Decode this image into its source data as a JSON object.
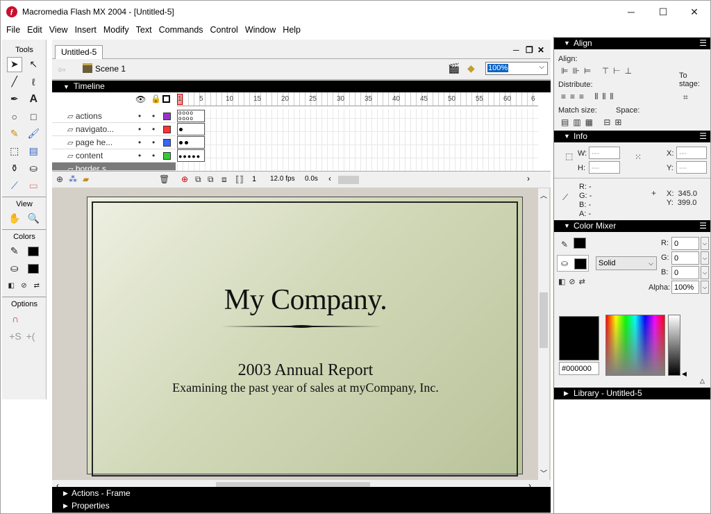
{
  "window": {
    "title": "Macromedia Flash MX 2004 - [Untitled-5]",
    "controls": {
      "minimize": "─",
      "maximize": "☐",
      "close": "✕"
    }
  },
  "menu": [
    "File",
    "Edit",
    "View",
    "Insert",
    "Modify",
    "Text",
    "Commands",
    "Control",
    "Window",
    "Help"
  ],
  "tools": {
    "header": "Tools",
    "view_label": "View",
    "colors_label": "Colors",
    "options_label": "Options"
  },
  "document": {
    "tab": "Untitled-5",
    "scene": "Scene 1",
    "zoom": "100%"
  },
  "timeline": {
    "title": "Timeline",
    "layers": [
      "actions",
      "navigato...",
      "page he...",
      "content",
      "border s..."
    ],
    "layer_colors": [
      "#9933cc",
      "#ff3333",
      "#3366ff",
      "#33cc33",
      "#9933cc"
    ],
    "ruler": [
      "1",
      "5",
      "10",
      "15",
      "20",
      "25",
      "30",
      "35",
      "40",
      "45",
      "50",
      "55",
      "60",
      "6"
    ],
    "current_frame": "1",
    "fps": "12.0 fps",
    "time": "0.0s"
  },
  "stage": {
    "heading": "My Company.",
    "subtitle": "2003 Annual Report",
    "tagline": "Examining the past year of sales at myCompany, Inc."
  },
  "bottom_panels": {
    "actions": "Actions - Frame",
    "properties": "Properties"
  },
  "align_panel": {
    "title": "Align",
    "align_label": "Align:",
    "distribute_label": "Distribute:",
    "match_size_label": "Match size:",
    "space_label": "Space:",
    "to_stage_label": "To stage:"
  },
  "info_panel": {
    "title": "Info",
    "w_label": "W:",
    "h_label": "H:",
    "x_label": "X:",
    "y_label": "Y:",
    "w": "---",
    "h": "---",
    "x": "---",
    "y": "---",
    "r": "R: -",
    "g": "G: -",
    "b": "B: -",
    "a": "A: -",
    "cursor_x": "X:  345.0",
    "cursor_y": "Y:  399.0"
  },
  "color_mixer": {
    "title": "Color Mixer",
    "fill_type": "Solid",
    "r_label": "R:",
    "g_label": "G:",
    "b_label": "B:",
    "alpha_label": "Alpha:",
    "r": "0",
    "g": "0",
    "b": "0",
    "alpha": "100%",
    "hex": "#000000"
  },
  "library": {
    "title": "Library - Untitled-5"
  }
}
